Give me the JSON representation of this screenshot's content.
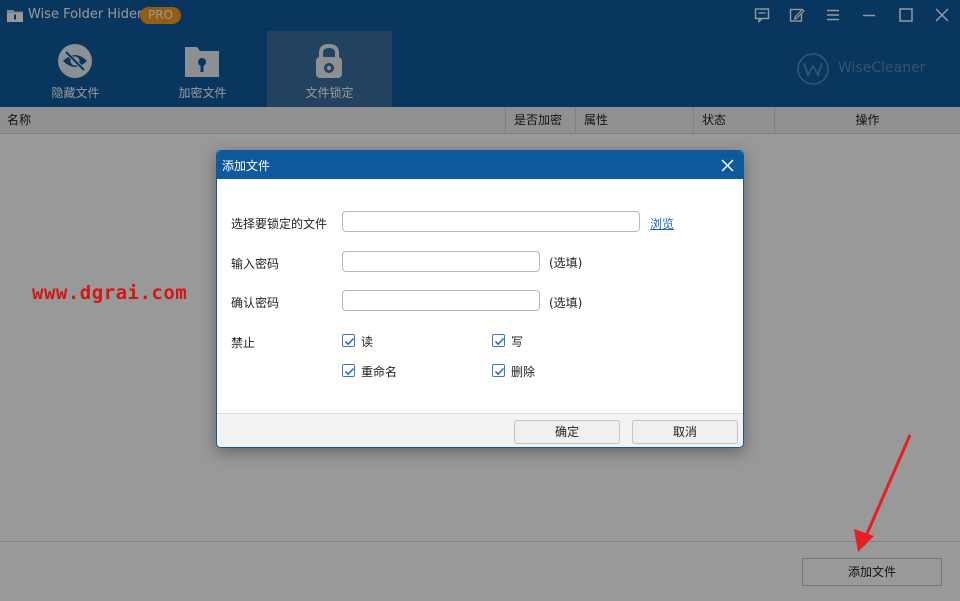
{
  "window": {
    "title": "Wise Folder Hider",
    "badge": "PRO"
  },
  "toolbar": {
    "tabs": [
      {
        "label": "隐藏文件",
        "icon": "eye-slash-icon"
      },
      {
        "label": "加密文件",
        "icon": "folder-lock-icon"
      },
      {
        "label": "文件锁定",
        "icon": "padlock-icon",
        "active": true
      }
    ],
    "brand": "WiseCleaner"
  },
  "table": {
    "columns": [
      "名称",
      "是否加密",
      "属性",
      "状态",
      "操作"
    ]
  },
  "footer": {
    "add_button": "添加文件"
  },
  "watermark": "www.dgrai.com",
  "dialog": {
    "title": "添加文件",
    "file_label": "选择要锁定的文件",
    "file_value": "",
    "browse_label": "浏览",
    "password_label": "输入密码",
    "password_value": "",
    "password_note": "(选填)",
    "confirm_label": "确认密码",
    "confirm_value": "",
    "confirm_note": "(选填)",
    "forbid_label": "禁止",
    "options": [
      {
        "label": "读",
        "checked": true
      },
      {
        "label": "写",
        "checked": true
      },
      {
        "label": "重命名",
        "checked": true
      },
      {
        "label": "删除",
        "checked": true
      }
    ],
    "ok_button": "确定",
    "cancel_button": "取消"
  },
  "colors": {
    "title_bar": "#0f5a9e",
    "badge": "#f59d1e",
    "active_tab": "#3a6f9e",
    "link": "#1a66c4",
    "watermark": "#d11818",
    "arrow": "#e81e25"
  }
}
